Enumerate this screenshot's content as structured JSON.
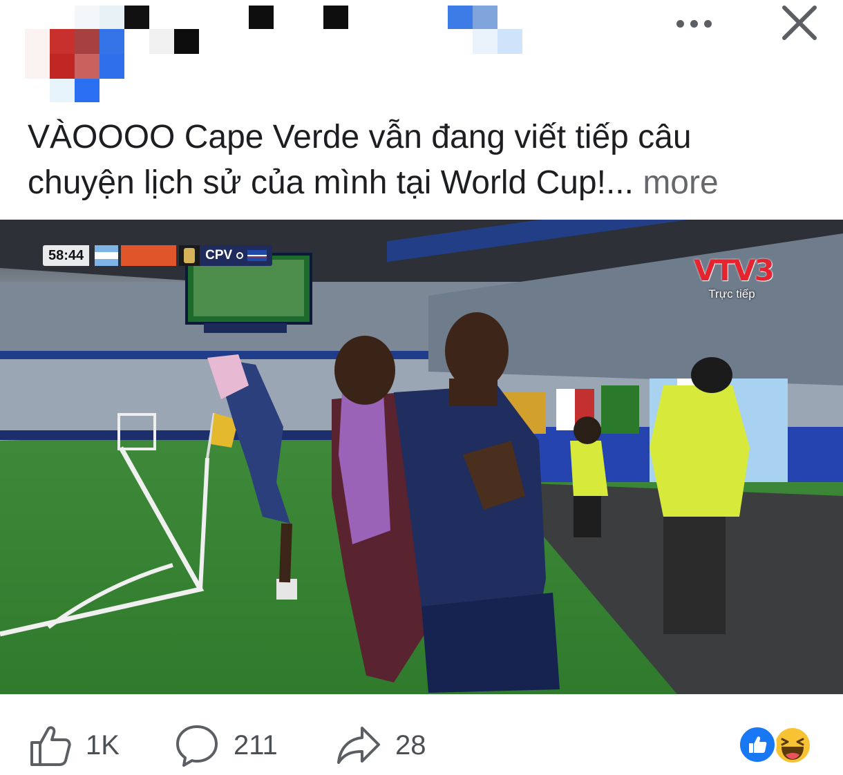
{
  "post": {
    "caption_line1": "VÀOOOO Cape Verde vẫn đang viết tiếp câu",
    "caption_line2": "chuyện lịch sử của mình tại World Cup!...",
    "more_label": "more"
  },
  "video": {
    "scoreboard": {
      "time": "58:44",
      "team_right": "CPV"
    },
    "broadcaster": {
      "logo_text": "VTV3",
      "status": "Trực tiếp"
    }
  },
  "stats": {
    "likes": "1K",
    "comments": "211",
    "shares": "28"
  },
  "icons": {
    "more": "more-options-icon",
    "close": "close-icon",
    "like": "thumbs-up-icon",
    "comment": "comment-icon",
    "share": "share-icon",
    "reaction_like": "like-reaction-icon",
    "reaction_haha": "haha-reaction-icon"
  },
  "colors": {
    "brand_blue": "#1877f2",
    "text": "#1c1e21",
    "muted": "#65676b"
  }
}
